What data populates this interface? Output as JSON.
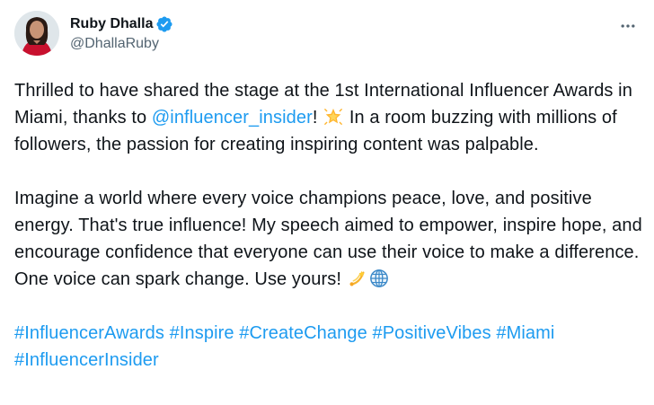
{
  "author": {
    "display_name": "Ruby Dhalla",
    "handle": "@DhallaRuby",
    "verified": true,
    "verified_color": "#1d9bf0"
  },
  "more_icon": "more-horizontal-icon",
  "tweet": {
    "p1_before": "Thrilled to have shared the stage at the 1st International Influencer Awards in Miami, thanks to ",
    "p1_mention": "@influencer_insider",
    "p1_after_mention": "! ",
    "p1_emoji": "glowing-star-emoji",
    "p1_rest": " In a room buzzing with millions of followers, the passion for creating inspiring content was palpable.",
    "p2_text": "Imagine a world where every voice champions peace, love, and positive energy. That's true influence! My speech aimed to empower, inspire hope, and encourage confidence that everyone can use their voice to make a difference. One voice can spark change. Use yours! ",
    "p2_emojis": [
      "dizzy-emoji",
      "globe-meridians-emoji"
    ],
    "hashtags": [
      "#InfluencerAwards",
      "#Inspire",
      "#CreateChange",
      "#PositiveVibes",
      "#Miami",
      "#InfluencerInsider"
    ]
  },
  "colors": {
    "text": "#0f1419",
    "secondary": "#536471",
    "link": "#1d9bf0",
    "background": "#ffffff"
  }
}
